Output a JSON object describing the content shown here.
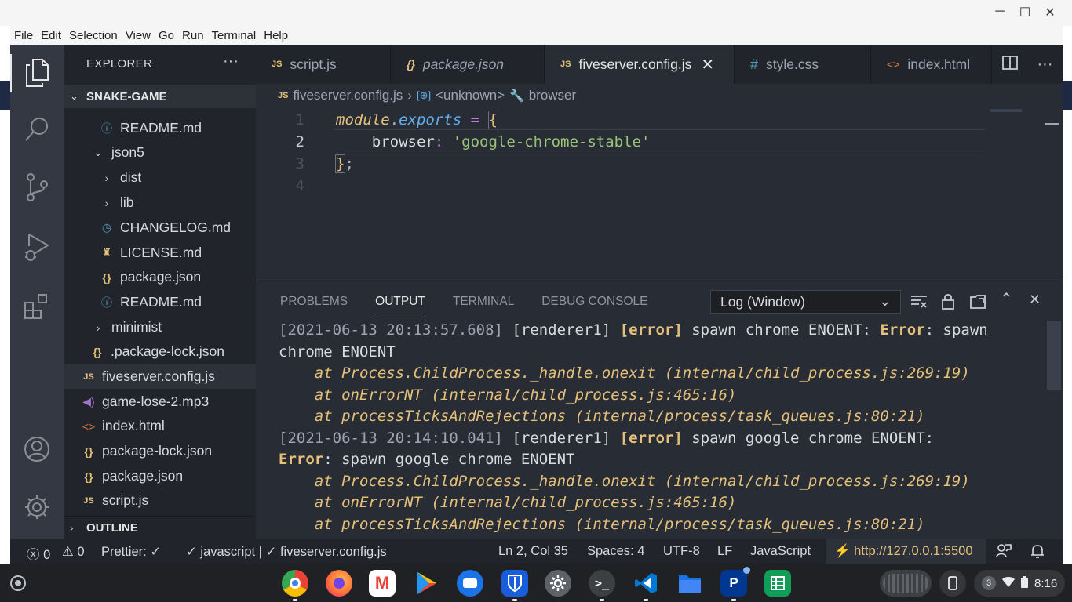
{
  "window": {
    "minimize": "─",
    "maximize": "☐",
    "close": "✕"
  },
  "menu": [
    "File",
    "Edit",
    "Selection",
    "View",
    "Go",
    "Run",
    "Terminal",
    "Help"
  ],
  "explorer": {
    "title": "EXPLORER",
    "more": "···",
    "section": "SNAKE-GAME",
    "items": [
      {
        "label": "README.md",
        "icon": "ⓘ"
      },
      {
        "label": "json5",
        "icon": "⌄"
      },
      {
        "label": "dist",
        "icon": "›"
      },
      {
        "label": "lib",
        "icon": "›"
      },
      {
        "label": "CHANGELOG.md",
        "icon": "◷"
      },
      {
        "label": "LICENSE.md",
        "icon": "♜"
      },
      {
        "label": "package.json",
        "icon": "{}"
      },
      {
        "label": "README.md",
        "icon": "ⓘ"
      },
      {
        "label": "minimist",
        "icon": "›"
      },
      {
        "label": ".package-lock.json",
        "icon": "{}"
      },
      {
        "label": "fiveserver.config.js",
        "icon": "JS"
      },
      {
        "label": "game-lose-2.mp3",
        "icon": "◀)"
      },
      {
        "label": "index.html",
        "icon": "<>"
      },
      {
        "label": "package-lock.json",
        "icon": "{}"
      },
      {
        "label": "package.json",
        "icon": "{}"
      },
      {
        "label": "script.js",
        "icon": "JS"
      }
    ],
    "outline": "OUTLINE"
  },
  "tabs": [
    {
      "label": "script.js",
      "icon": "JS"
    },
    {
      "label": "package.json",
      "icon": "{}"
    },
    {
      "label": "fiveserver.config.js",
      "icon": "JS",
      "close": "✕"
    },
    {
      "label": "style.css",
      "icon": "#"
    },
    {
      "label": "index.html",
      "icon": "<>"
    }
  ],
  "breadcrumb": {
    "file_icon": "JS",
    "file": "fiveserver.config.js",
    "sep": "›",
    "sym1_icon": "[⊕]",
    "sym1": "<unknown>",
    "sym2_icon": "🔧",
    "sym2": "browser"
  },
  "code": {
    "line_numbers": [
      "1",
      "2",
      "3",
      "4"
    ],
    "l1_module": "module",
    "l1_dot": ".",
    "l1_exports": "exports",
    "l1_eq": " = ",
    "l1_brace": "{",
    "l2_indent": "    ",
    "l2_key": "browser",
    "l2_colon": ":",
    "l2_str": " 'google-chrome-stable'",
    "l3_brace": "}",
    "l3_semi": ";"
  },
  "panel": {
    "tabs": [
      "PROBLEMS",
      "OUTPUT",
      "TERMINAL",
      "DEBUG CONSOLE"
    ],
    "dropdown": "Log (Window)",
    "chevron": "⌄",
    "log": {
      "r1_ts": "[2021-06-13 20:13:57.608]",
      "r1_src": " [renderer1] ",
      "r1_err": "[error]",
      "r1_msg": " spawn chrome ENOENT: ",
      "r1_err2": "Error",
      "r1_msg2": ": spawn",
      "r2": "chrome ENOENT",
      "r3": "    at Process.ChildProcess._handle.onexit (internal/child_process.js:269:19)",
      "r4": "    at onErrorNT (internal/child_process.js:465:16)",
      "r5": "    at processTicksAndRejections (internal/process/task_queues.js:80:21)",
      "r6_ts": "[2021-06-13 20:14:10.041]",
      "r6_src": " [renderer1] ",
      "r6_err": "[error]",
      "r6_msg": " spawn google chrome ENOENT:",
      "r7_err": "Error",
      "r7_msg": ": spawn google chrome ENOENT",
      "r8": "    at Process.ChildProcess._handle.onexit (internal/child_process.js:269:19)",
      "r9": "    at onErrorNT (internal/child_process.js:465:16)",
      "r10": "    at processTicksAndRejections (internal/process/task_queues.js:80:21)"
    }
  },
  "status": {
    "errors": "ⓧ 0",
    "warnings": "⚠ 0",
    "prettier": "Prettier: ✓",
    "language_check": "✓ javascript | ✓ fiveserver.config.js",
    "position": "Ln 2, Col 35",
    "spaces": "Spaces: 4",
    "encoding": "UTF-8",
    "eol": "LF",
    "language": "JavaScript",
    "live_server": "⚡ http://127.0.0.1:5500"
  },
  "shelf": {
    "apps": [
      "Chrome",
      "Firefox",
      "Gmail",
      "Play Store",
      "Messages",
      "Bitwarden",
      "Settings",
      "Terminal",
      "VS Code",
      "Files",
      "PlayStation",
      "Sheets"
    ],
    "notification_count": "3",
    "time": "8:16"
  },
  "colors": {
    "accent": "#e5c07b",
    "editor_bg": "#282c34",
    "sidebar_bg": "#21252b",
    "activity_bg": "#333842",
    "panel_border": "#c24040"
  }
}
